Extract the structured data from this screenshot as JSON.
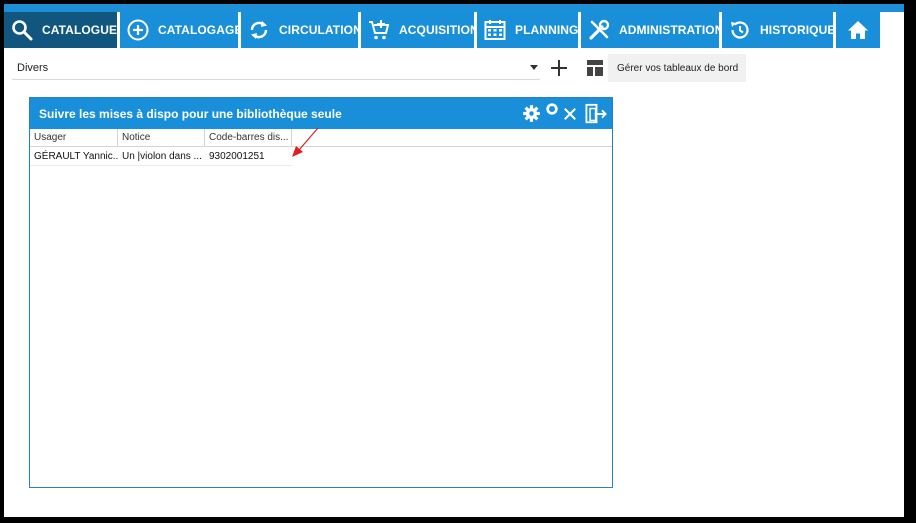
{
  "nav": {
    "items": [
      {
        "label": "CATALOGUE",
        "icon": "search-icon",
        "active": true
      },
      {
        "label": "CATALOGAGE",
        "icon": "plus-circle-icon"
      },
      {
        "label": "CIRCULATION",
        "icon": "refresh-icon"
      },
      {
        "label": "ACQUISITION",
        "icon": "cart-icon"
      },
      {
        "label": "PLANNING",
        "icon": "calendar-icon"
      },
      {
        "label": "ADMINISTRATION",
        "icon": "tools-icon"
      },
      {
        "label": "HISTORIQUE",
        "icon": "history-icon"
      },
      {
        "label": "",
        "icon": "home-icon"
      }
    ]
  },
  "dashboard": {
    "selected": "Divers",
    "manage_label": "Gérer vos tableaux de bord"
  },
  "widget": {
    "title": "Suivre les mises à dispo pour une bibliothèque seule",
    "columns": [
      "Usager",
      "Notice",
      "Code-barres dis..."
    ],
    "rows": [
      [
        "GÉRAULT Yannic...",
        "Un |violon dans ...",
        "9302001251"
      ]
    ]
  },
  "colors": {
    "nav_blue": "#1a8fd9",
    "nav_active": "#10567f",
    "annotation_red": "#e02020"
  }
}
